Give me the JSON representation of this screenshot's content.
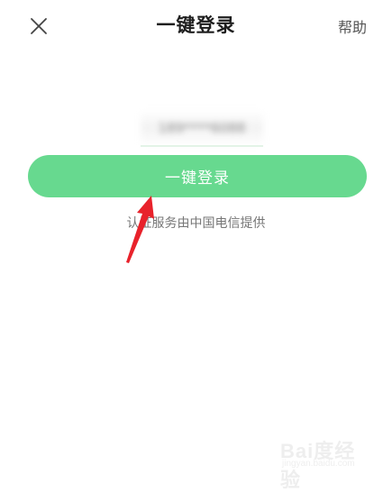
{
  "header": {
    "title": "一键登录",
    "help_label": "帮助",
    "close_icon": "close-icon"
  },
  "login": {
    "masked_phone": "189****6088",
    "button_label": "一键登录",
    "provider_note": "认证服务由中国电信提供"
  },
  "watermark": {
    "logo": "Bai度经验",
    "url": "jingyan.baidu.com"
  },
  "colors": {
    "accent_green": "#67d98f",
    "arrow_red": "#e8222b"
  }
}
